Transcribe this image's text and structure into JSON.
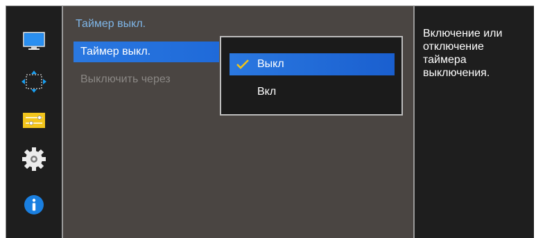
{
  "sidebar": {
    "icons": [
      "monitor-icon",
      "screen-size-icon",
      "sliders-icon",
      "gear-icon",
      "info-icon"
    ]
  },
  "main": {
    "title": "Таймер выкл.",
    "items": [
      {
        "label": "Таймер выкл.",
        "state": "selected"
      },
      {
        "label": "Выключить через",
        "state": "disabled"
      }
    ]
  },
  "dropdown": {
    "options": [
      {
        "label": "Выкл",
        "active": true
      },
      {
        "label": "Вкл",
        "active": false
      }
    ]
  },
  "help": {
    "text_lines": [
      "Включение или",
      "отключение",
      "таймера",
      "выключения."
    ]
  },
  "colors": {
    "accent": "#2a78e0",
    "title": "#7fb6e8",
    "check": "#f0c419",
    "panel": "#4a4542"
  }
}
